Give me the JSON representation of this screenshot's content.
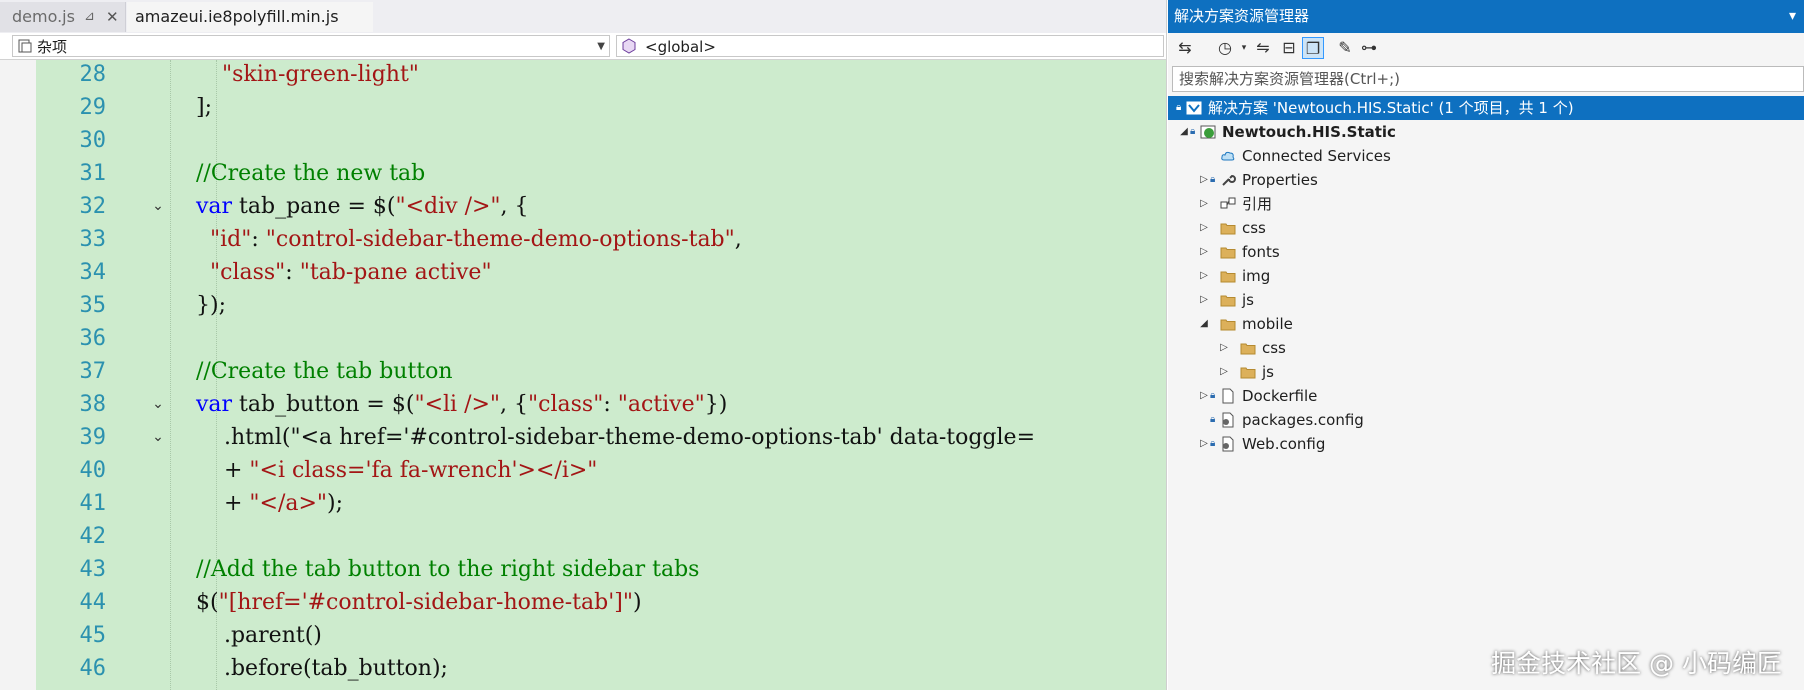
{
  "editor": {
    "tabs": [
      {
        "label": "demo.js",
        "pin": "⊿",
        "close": "✕"
      },
      {
        "label": "amazeui.ie8polyfill.min.js"
      }
    ],
    "nav_left": "杂项",
    "nav_right": "<global>",
    "lines": [
      {
        "num": "28",
        "text": "\"skin-green-light\"",
        "fold": ""
      },
      {
        "num": "29",
        "text": "];",
        "fold": ""
      },
      {
        "num": "30",
        "text": "",
        "fold": ""
      },
      {
        "num": "31",
        "text": "//Create the new tab",
        "fold": ""
      },
      {
        "num": "32",
        "text": "var tab_pane = $(\"<div />\", {",
        "fold": "⌄"
      },
      {
        "num": "33",
        "text": "  \"id\": \"control-sidebar-theme-demo-options-tab\",",
        "fold": ""
      },
      {
        "num": "34",
        "text": "  \"class\": \"tab-pane active\"",
        "fold": ""
      },
      {
        "num": "35",
        "text": "});",
        "fold": ""
      },
      {
        "num": "36",
        "text": "",
        "fold": ""
      },
      {
        "num": "37",
        "text": "//Create the tab button",
        "fold": ""
      },
      {
        "num": "38",
        "text": "var tab_button = $(\"<li />\", {\"class\": \"active\"})",
        "fold": "⌄"
      },
      {
        "num": "39",
        "text": "    .html(\"<a href='#control-sidebar-theme-demo-options-tab' data-toggle=",
        "fold": "⌄"
      },
      {
        "num": "40",
        "text": "    + \"<i class='fa fa-wrench'></i>\"",
        "fold": ""
      },
      {
        "num": "41",
        "text": "    + \"</a>\");",
        "fold": ""
      },
      {
        "num": "42",
        "text": "",
        "fold": ""
      },
      {
        "num": "43",
        "text": "//Add the tab button to the right sidebar tabs",
        "fold": ""
      },
      {
        "num": "44",
        "text": "$(\"[href='#control-sidebar-home-tab']\")",
        "fold": ""
      },
      {
        "num": "45",
        "text": "    .parent()",
        "fold": ""
      },
      {
        "num": "46",
        "text": "    .before(tab_button);",
        "fold": ""
      }
    ]
  },
  "solution_explorer": {
    "title": "解决方案资源管理器",
    "search_placeholder": "搜索解决方案资源管理器(Ctrl+;)",
    "solution": "解决方案 'Newtouch.HIS.Static' (1 个项目，共 1 个)",
    "items": [
      {
        "label": "Newtouch.HIS.Static",
        "indent": 0,
        "expander": "◢",
        "icon": "web-project",
        "lock": true
      },
      {
        "label": "Connected Services",
        "indent": 1,
        "expander": "",
        "icon": "cloud",
        "lock": false
      },
      {
        "label": "Properties",
        "indent": 1,
        "expander": "▷",
        "icon": "wrench",
        "lock": true
      },
      {
        "label": "引用",
        "indent": 1,
        "expander": "▷",
        "icon": "reference",
        "lock": false
      },
      {
        "label": "css",
        "indent": 1,
        "expander": "▷",
        "icon": "folder",
        "lock": false
      },
      {
        "label": "fonts",
        "indent": 1,
        "expander": "▷",
        "icon": "folder",
        "lock": false
      },
      {
        "label": "img",
        "indent": 1,
        "expander": "▷",
        "icon": "folder",
        "lock": false
      },
      {
        "label": "js",
        "indent": 1,
        "expander": "▷",
        "icon": "folder",
        "lock": false
      },
      {
        "label": "mobile",
        "indent": 1,
        "expander": "◢",
        "icon": "folder",
        "lock": false
      },
      {
        "label": "css",
        "indent": 2,
        "expander": "▷",
        "icon": "folder",
        "lock": false
      },
      {
        "label": "js",
        "indent": 2,
        "expander": "▷",
        "icon": "folder",
        "lock": false
      },
      {
        "label": "Dockerfile",
        "indent": 1,
        "expander": "▷",
        "icon": "file",
        "lock": true
      },
      {
        "label": "packages.config",
        "indent": 1,
        "expander": "",
        "icon": "config",
        "lock": true
      },
      {
        "label": "Web.config",
        "indent": 1,
        "expander": "▷",
        "icon": "config",
        "lock": true
      }
    ]
  },
  "watermark": "掘金技术社区 @ 小码编匠",
  "colors": {
    "code_bg": "#cdebcd",
    "keyword": "#0000ff",
    "string": "#a31515",
    "comment": "#008000",
    "line_number": "#2b91af",
    "accent": "#0e70c0"
  }
}
